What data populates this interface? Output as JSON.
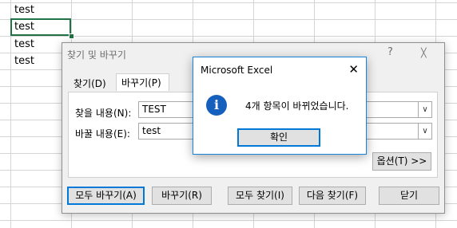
{
  "sheet": {
    "cells": [
      "test",
      "test",
      "test",
      "test"
    ]
  },
  "find_replace": {
    "title": "찾기 및 바꾸기",
    "help_glyph": "?",
    "close_glyph": "╳",
    "tabs": [
      {
        "label": "찾기(D)",
        "active": false
      },
      {
        "label": "바꾸기(P)",
        "active": true
      }
    ],
    "find_label": "찾을 내용(N):",
    "find_value": "TEST",
    "replace_label": "바꿀 내용(E):",
    "replace_value": "test",
    "combo_arrow": "∨",
    "options_button": "옵션(T) >>",
    "buttons": {
      "replace_all": "모두 바꾸기(A)",
      "replace": "바꾸기(R)",
      "find_all": "모두 찾기(I)",
      "find_next": "다음 찾기(F)",
      "close": "닫기"
    }
  },
  "message_box": {
    "title": "Microsoft Excel",
    "close_glyph": "✕",
    "icon": "info-icon",
    "icon_glyph": "i",
    "message": "4개 항목이 바뀌었습니다.",
    "ok_label": "확인",
    "accent_color": "#1560bd"
  },
  "colors": {
    "selection": "#217346",
    "default_button_border": "#0078d7"
  }
}
